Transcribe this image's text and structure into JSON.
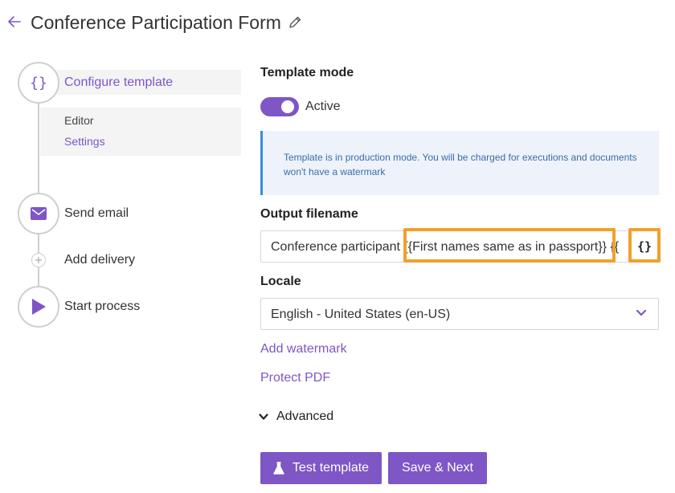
{
  "header": {
    "title": "Conference Participation Form"
  },
  "steps": {
    "configure": {
      "label": "Configure template",
      "icon_text": "{}"
    },
    "sub": {
      "editor": "Editor",
      "settings": "Settings"
    },
    "send_email": {
      "label": "Send email"
    },
    "add_delivery": {
      "label": "Add delivery"
    },
    "start_process": {
      "label": "Start process"
    }
  },
  "template_mode": {
    "label": "Template mode",
    "toggle_label": "Active",
    "toggle_on": true
  },
  "info_text": "Template is in production mode. You will be charged for executions and documents won't have a watermark",
  "output_filename": {
    "label": "Output filename",
    "prefix": "Conference participant ",
    "placeholder_tag": "{{First names same as in passport}}",
    "trailing": " {{",
    "insert_button": "{}"
  },
  "locale": {
    "label": "Locale",
    "value": "English - United States (en-US)"
  },
  "links": {
    "add_watermark": "Add watermark",
    "protect_pdf": "Protect PDF"
  },
  "advanced": {
    "label": "Advanced"
  },
  "buttons": {
    "test_template": "Test template",
    "save_next": "Save & Next"
  },
  "colors": {
    "accent": "#7e56c6",
    "highlight": "#f2a02d",
    "info_border": "#3a8bd6",
    "info_bg": "#edf2fb"
  }
}
